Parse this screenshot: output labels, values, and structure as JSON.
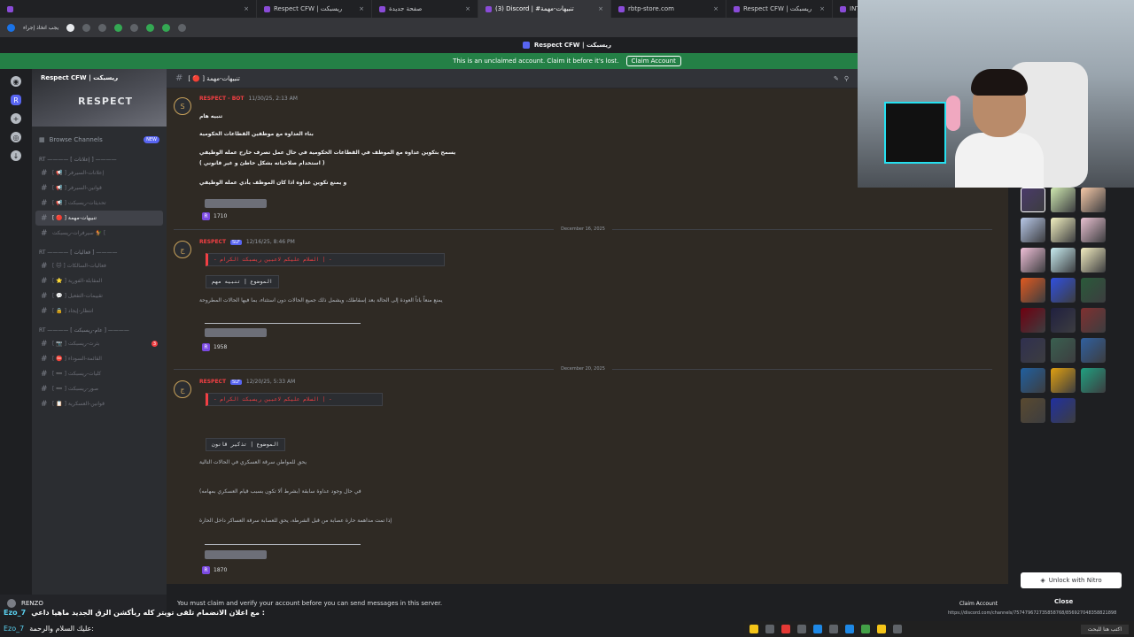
{
  "browser": {
    "tabs": [
      {
        "label": "",
        "active": false
      },
      {
        "label": "Respect CFW | ريسبكت",
        "active": false
      },
      {
        "label": "صفحة جديدة",
        "active": false
      },
      {
        "label": "(3) Discord | #تنبيهات-مهمة",
        "active": true
      },
      {
        "label": "rbtp-store.com",
        "active": false
      },
      {
        "label": "Respect CFW | ريسبكت",
        "active": false
      },
      {
        "label": "INTJ-T - بحث Goo",
        "active": false
      }
    ],
    "toolbar_label": "يجب اتخاذ إجراء"
  },
  "discord": {
    "window_title": "Respect CFW | ريسبكت",
    "banner": {
      "text": "This is an unclaimed account. Claim it before it's lost.",
      "button": "Claim Account"
    },
    "server": {
      "name": "Respect CFW | ريسبكت",
      "logo_text": "RESPECT"
    },
    "browse_channels": "Browse Channels",
    "new_badge": "NEW",
    "categories": [
      {
        "label": "RT ———— [ إعلانات ] ————",
        "channels": [
          {
            "name": "[ 📢 ] إعلانات-السيرفر",
            "selected": false,
            "badge": ""
          },
          {
            "name": "[ 📢 ] قوانين-السيرفر",
            "selected": false,
            "badge": ""
          },
          {
            "name": "[ 📢 ] تحديثات-ريسبكت",
            "selected": false,
            "badge": ""
          },
          {
            "name": "[ 🔴 ] تنبيهات-مهمة",
            "selected": true,
            "badge": ""
          },
          {
            "name": "سيرفرات-ريسبكت 🐓 [",
            "selected": false,
            "badge": ""
          }
        ]
      },
      {
        "label": "RT ———— [ فعاليات ] ————",
        "channels": [
          {
            "name": "[ 🐱 ] فعاليات-السالكات",
            "selected": false,
            "badge": ""
          },
          {
            "name": "[ ⭐ ] المقابلة-الفورية",
            "selected": false,
            "badge": ""
          },
          {
            "name": "[ 💬 ] تقييمات-التفعيل",
            "selected": false,
            "badge": ""
          },
          {
            "name": "[ 🔒 ] انتظار-إيجاد",
            "selected": false,
            "badge": ""
          }
        ]
      },
      {
        "label": "RT ———— [ عام-ريسبكت ] ————",
        "channels": [
          {
            "name": "[ 📷 ] بثرث-ريسبكت",
            "selected": false,
            "badge": "3"
          },
          {
            "name": "[ ⛔ ] القائمة-السوداء",
            "selected": false,
            "badge": ""
          },
          {
            "name": "[ ➖ ] كليات-ريسبكت",
            "selected": false,
            "badge": ""
          },
          {
            "name": "[ ➖ ] صور-ريسبكت",
            "selected": false,
            "badge": ""
          },
          {
            "name": "[ 📋 ] قوانين-العسكرية",
            "selected": false,
            "badge": ""
          }
        ]
      }
    ],
    "user": {
      "name": "RENZO"
    },
    "channel_header": "[ 🔴 ] تنبيهات-مهمة",
    "messages": [
      {
        "author": "RESPECT - BOT",
        "tag": "",
        "time": "11/30/25, 2:13 AM",
        "lines": [
          {
            "text": "تنبيه هام",
            "style": "b"
          },
          {
            "text": "بناء العداوه مع موظفين القطاعات الحكومية",
            "style": "b"
          },
          {
            "text": "يسمح بتكوين عداوه مع الموظف في القطاعات الحكومية في حال عمل تصرف خارج عمله الوظيفي",
            "style": "b"
          },
          {
            "text": "( استخدام صلاحياته بشكل خاطئ و غير قانوني )",
            "style": "b"
          },
          {
            "text": "و يمنع تكوين عداوه اذا كان الموظف يأدي عمله الوظيفي",
            "style": "b"
          }
        ],
        "reaction": "1710"
      },
      {
        "date": "December 16, 2025",
        "author": "RESPECT",
        "tag": "SLF",
        "time": "12/16/25, 8:46 PM",
        "code_red": "-  السلام عليكم لاعبين ريسبكت الكرام  |  -",
        "code": "الموضوع | تنبيه مهم",
        "lines": [
          {
            "text": "يمنع منعاً باتاً العودة إلى الحالة بعد إسقاطك، ويشمل ذلك جميع الحالات دون استثناء، بما فيها الحالات المطروحة",
            "style": "dim"
          }
        ],
        "reaction": "1958"
      },
      {
        "date": "December 20, 2025",
        "author": "RESPECT",
        "tag": "SLF",
        "time": "12/20/25, 5:33 AM",
        "code_red": "-  السلام عليكم لاعبين ريسبكت الكرام  |  -",
        "code": "الموضوع | تذكير قانون",
        "lines": [
          {
            "text": "يحق للمواطن سرقة العسكري في الحالات التالية",
            "style": "dim"
          },
          {
            "text": "في حال وجود عداوة سابقة (بشرط ألا تكون بسبب قيام العسكري بمهامه)",
            "style": "dim"
          },
          {
            "text": "إذا تمت مداهمة حارة عصابة من قبل الشرطة، يحق للعصابة سرقة العساكر داخل الحارة",
            "style": "dim"
          }
        ],
        "reaction": "1870"
      }
    ],
    "bottom_notice": "You must claim and verify your account before you can send messages in this server.",
    "bottom_claim": "Claim Account",
    "nitro_button": "Unlock with Nitro",
    "close_label": "Close",
    "status_url": "https://discord.com/channels/757479672735858768/856927048358821898"
  },
  "stream_overlay": {
    "line1": {
      "name": "Ezo_7",
      "text": "مع اعلان الانضمام تلقى تويتر كله ريأكشن الزق الجديد ماهيا داعي :"
    },
    "line2": {
      "name": "Ezo_7",
      "text": "عليك السلام والرحمة:"
    }
  },
  "taskbar": {
    "search_placeholder": "اكتب هنا للبحث"
  },
  "colors": {
    "accent": "#5865f2",
    "banner": "#248046",
    "danger": "#f23f43",
    "chat_bg": "#2f2a24"
  }
}
